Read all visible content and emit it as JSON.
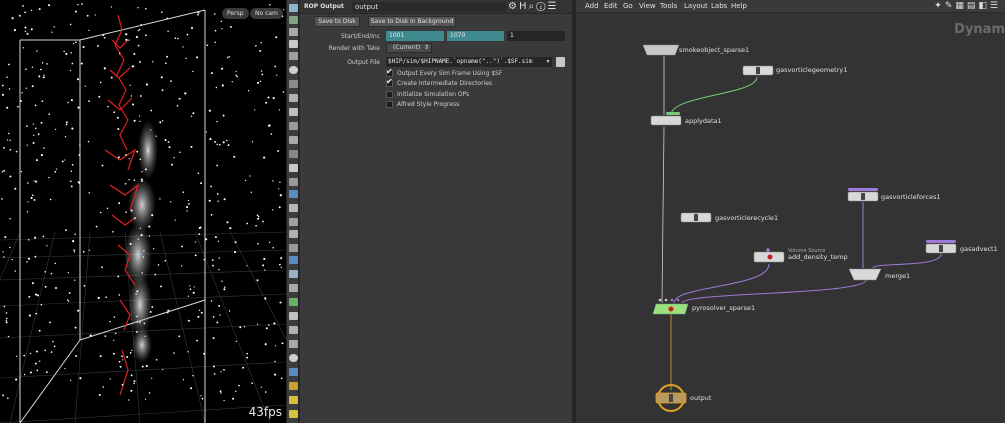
{
  "viewport": {
    "persp_label": "Persp",
    "cam_label": "No cam",
    "fps": "43fps"
  },
  "params": {
    "node_type": "ROP Output",
    "node_name": "output",
    "save_to_disk": "Save to Disk",
    "save_to_disk_bg": "Save to Disk in Background",
    "start_end_inc_label": "Start/End/Inc",
    "start": "1001",
    "end": "1070",
    "inc": "1",
    "render_with_take_label": "Render with Take",
    "render_with_take_value": "(Current)",
    "output_file_label": "Output File",
    "output_file_value": "$HIP/sim/$HIPNAME.`opname(\"..\")`.$SF.sim",
    "checkboxes": [
      {
        "label": "Output Every Sim Frame Using $SF",
        "checked": true
      },
      {
        "label": "Create Intermediate Directories",
        "checked": true
      },
      {
        "label": "Initialize Simulation OPs",
        "checked": false
      },
      {
        "label": "Alfred Style Progress",
        "checked": false
      }
    ]
  },
  "network": {
    "menu": [
      "Add",
      "Edit",
      "Go",
      "View",
      "Tools",
      "Layout",
      "Labs",
      "Help"
    ],
    "watermark": "Dynam",
    "nodes": {
      "smokeobject": "smokeobject_sparse1",
      "gasvorticlegeometry": "gasvorticlegeometry1",
      "applydata": "applydata1",
      "gasvorticleforces": "gasvorticleforces1",
      "gasvorticlerecycle": "gasvorticlerecycle1",
      "volume_source_sub": "Volume Source",
      "add_density": "add_density_temp",
      "gasadvect": "gasadvect1",
      "merge": "merge1",
      "pyrosolver": "pyrosolver_sparse1",
      "output": "output"
    }
  },
  "colors": {
    "teal_field": "#3f8a8f",
    "node_gray": "#c8c8c8",
    "wire_green": "#7bc87b",
    "wire_purple": "#a07ad8",
    "output_gold": "#e0a020",
    "pyro_green": "#9be07a"
  }
}
